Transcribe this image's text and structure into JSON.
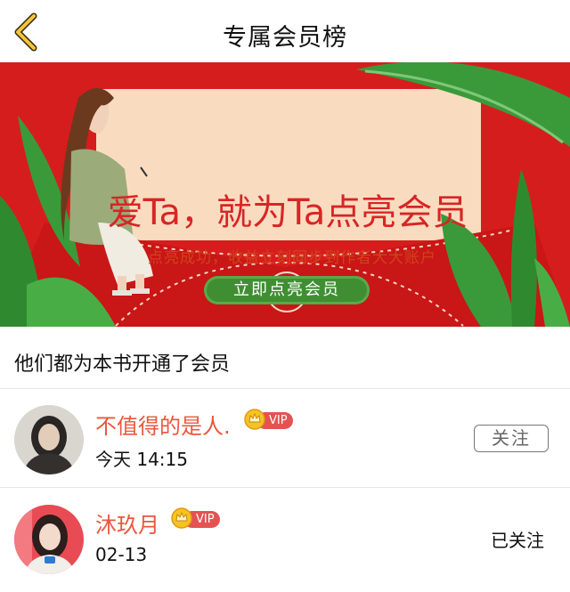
{
  "header": {
    "title": "专属会员榜",
    "back_icon": "chevron-left-icon"
  },
  "banner": {
    "headline": "爱Ta，就为Ta点亮会员",
    "subtitle": "点亮成功，收益立刻同步到作者大大账户",
    "cta_label": "立即点亮会员",
    "colors": {
      "background": "#d61d1d",
      "card": "#f9dcc0",
      "button": "#3f8f32",
      "leaf": "#3a9a3a"
    }
  },
  "section": {
    "title": "他们都为本书开通了会员"
  },
  "members": [
    {
      "name": "不值得的是人.",
      "badge": "VIP",
      "time": "今天 14:15",
      "follow_label": "关注",
      "followed": false
    },
    {
      "name": "沐玖月",
      "badge": "VIP",
      "time": "02-13",
      "follow_label": "已关注",
      "followed": true
    }
  ],
  "colors": {
    "name": "#e9573b",
    "vip_tag": "#e55252",
    "crown": "#f2b31b"
  }
}
